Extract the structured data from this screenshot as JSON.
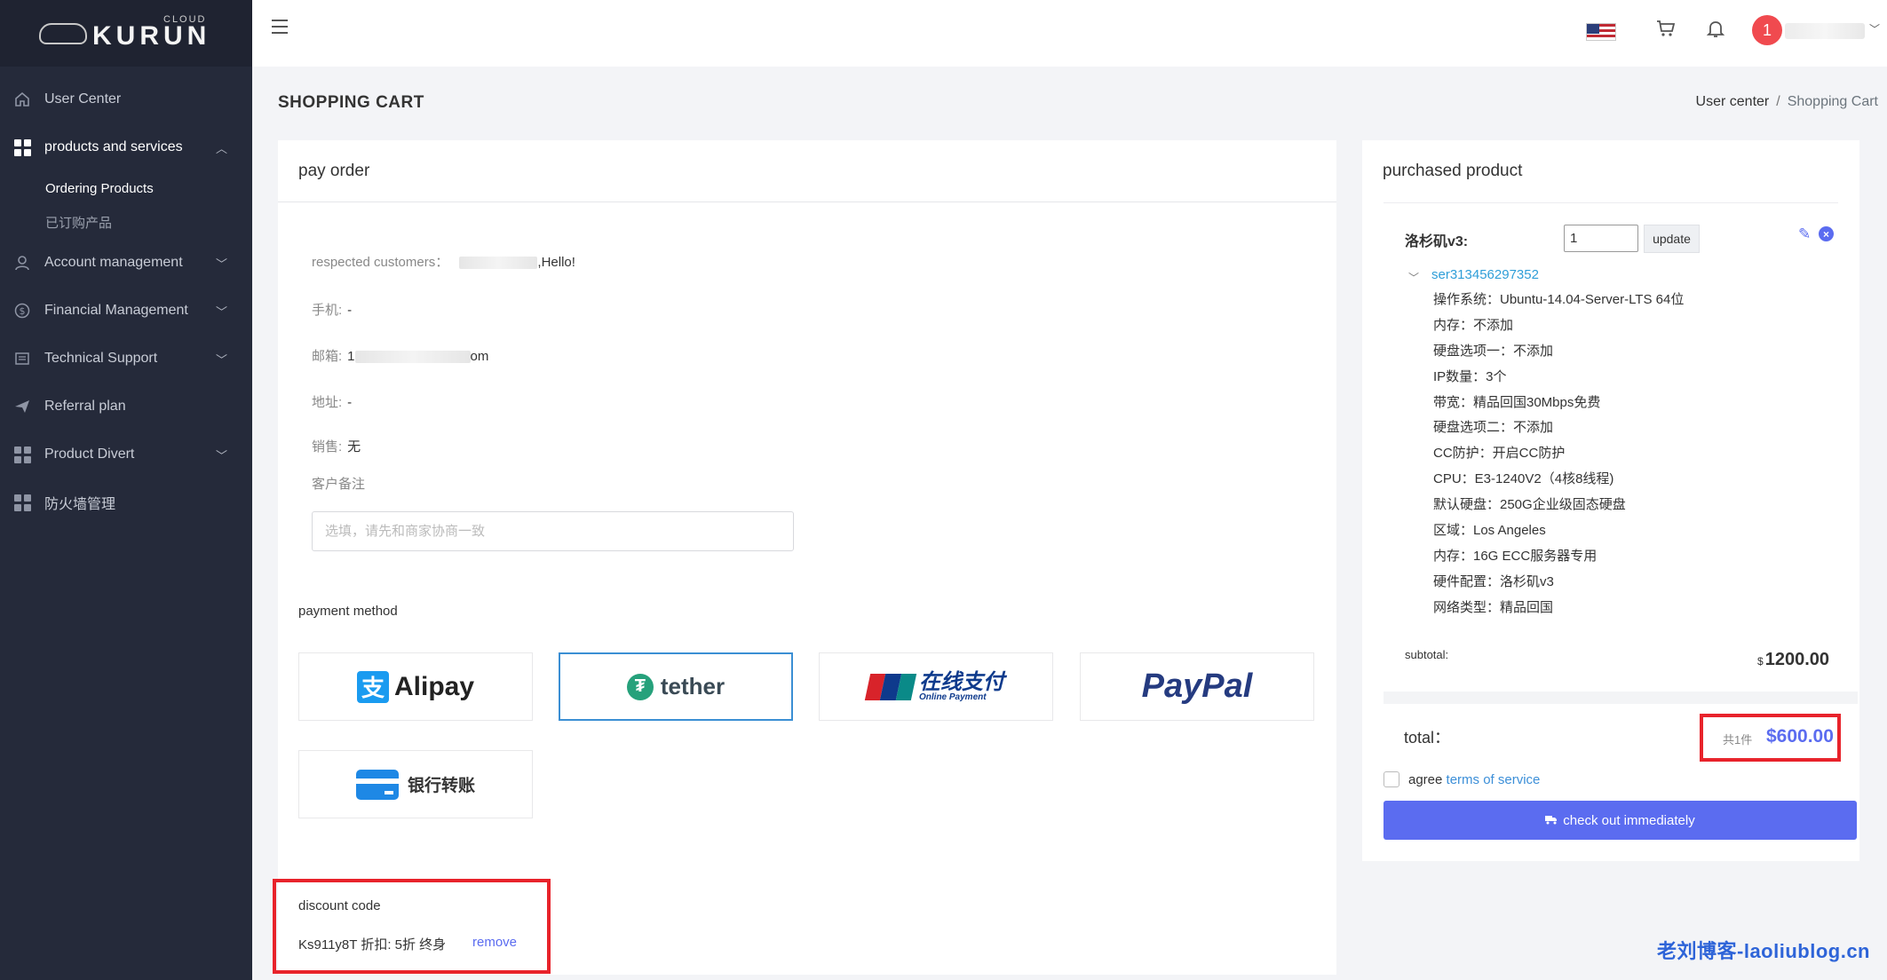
{
  "brand": {
    "logo_text": "KURUN",
    "logo_sup": "CLOUD"
  },
  "sidebar": {
    "items": [
      {
        "label": "User Center",
        "icon": "home-icon"
      },
      {
        "label": "products and services",
        "icon": "grid-icon",
        "expanded": true,
        "children": [
          {
            "label": "Ordering Products",
            "active": true
          },
          {
            "label": "已订购产品"
          }
        ]
      },
      {
        "label": "Account management",
        "icon": "user-icon"
      },
      {
        "label": "Financial Management",
        "icon": "dollar-icon"
      },
      {
        "label": "Technical Support",
        "icon": "ticket-icon"
      },
      {
        "label": "Referral plan",
        "icon": "send-icon"
      },
      {
        "label": "Product Divert",
        "icon": "grid-icon"
      },
      {
        "label": "防火墙管理",
        "icon": "grid-icon"
      }
    ]
  },
  "topbar": {
    "notification_count": "1",
    "icons": [
      "menu-icon",
      "us-flag-icon",
      "cart-icon",
      "bell-icon"
    ]
  },
  "header": {
    "title": "SHOPPING CART",
    "breadcrumb": [
      "User center",
      "Shopping Cart"
    ]
  },
  "pay_order": {
    "title": "pay order",
    "greeting_label": "respected customers：",
    "greeting_suffix": ",Hello!",
    "phone_label": "手机:",
    "phone_value": "-",
    "email_label": "邮箱:",
    "email_prefix": "1",
    "email_suffix": "om",
    "address_label": "地址:",
    "address_value": "-",
    "sales_label": "销售:",
    "sales_value": "无",
    "note_label": "客户备注",
    "note_placeholder": "选填，请先和商家协商一致",
    "payment_label": "payment method",
    "payment_methods": [
      "Alipay",
      "tether",
      "在线支付",
      "PayPal",
      "银行转账"
    ],
    "payment_selected": "tether",
    "unionpay_sub": "Online Payment",
    "discount_label": "discount code",
    "discount_value": "Ks911y8T 折扣: 5折 终身",
    "discount_remove": "remove"
  },
  "purchased": {
    "title": "purchased product",
    "product_name": "洛杉矶v3:",
    "quantity": "1",
    "update_label": "update",
    "serial": "ser313456297352",
    "specs": [
      "操作系统：Ubuntu-14.04-Server-LTS 64位",
      "内存：不添加",
      "硬盘选项一：不添加",
      "IP数量：3个",
      "带宽：精品回国30Mbps免费",
      "硬盘选项二：不添加",
      "CC防护：开启CC防护",
      "CPU：E3-1240V2（4核8线程)",
      "默认硬盘：250G企业级固态硬盘",
      "区域：Los Angeles",
      "内存：16G ECC服务器专用",
      "硬件配置：洛杉矶v3",
      "网络类型：精品回国"
    ],
    "subtotal_label": "subtotal:",
    "subtotal_currency": "$",
    "subtotal_value": "1200.00",
    "total_label": "total：",
    "total_count": "共1件",
    "total_value": "$600.00",
    "agree_text": "agree",
    "tos_link": "terms of service",
    "checkout_label": "check out immediately"
  },
  "watermark": "老刘博客-laoliublog.cn"
}
